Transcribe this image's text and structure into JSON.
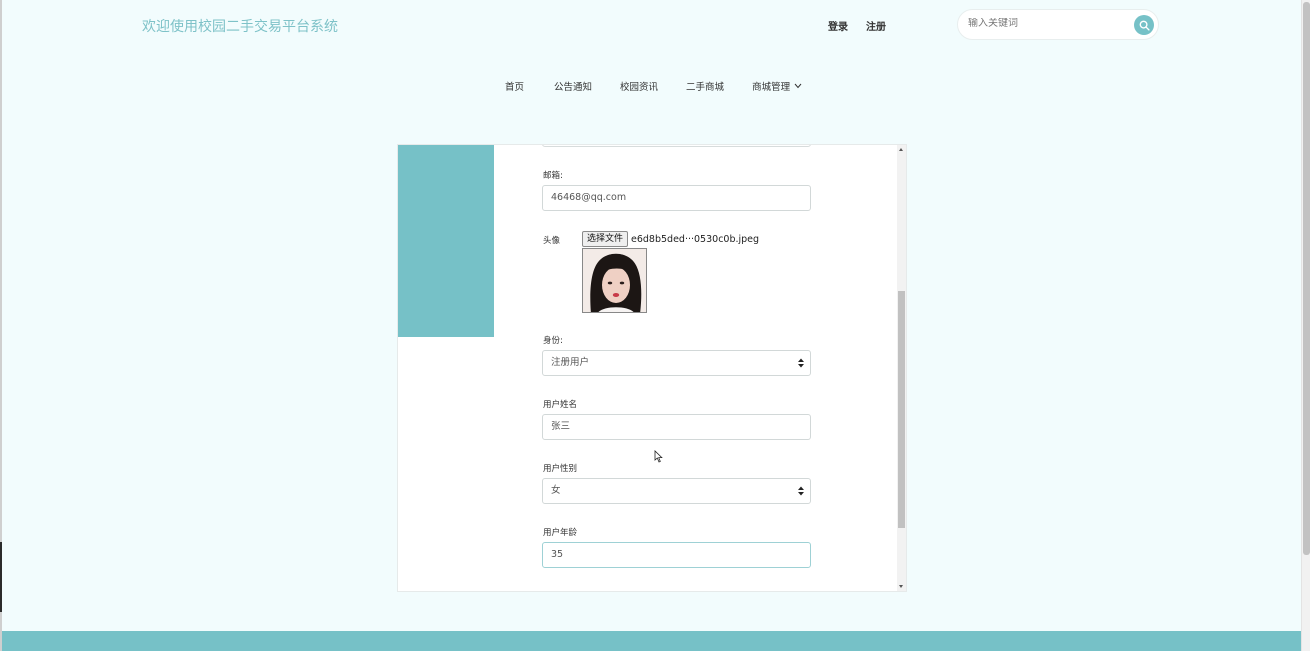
{
  "header": {
    "brand": "欢迎使用校园二手交易平台系统",
    "login_label": "登录",
    "register_label": "注册",
    "search_placeholder": "输入关键词"
  },
  "nav": {
    "items": [
      "首页",
      "公告通知",
      "校园资讯",
      "二手商城",
      "商城管理"
    ]
  },
  "form": {
    "email_label": "邮箱:",
    "email_value": "46468@qq.com",
    "avatar_label": "头像",
    "file_button_label": "选择文件",
    "file_name": "e6d8b5ded···0530c0b.jpeg",
    "identity_label": "身份:",
    "identity_value": "注册用户",
    "username_label": "用户姓名",
    "username_value": "张三",
    "gender_label": "用户性别",
    "gender_value": "女",
    "age_label": "用户年龄",
    "age_value": "35"
  },
  "colors": {
    "accent": "#76c1c7",
    "brand_text": "#7ec2c8",
    "background": "#f2fcfd"
  }
}
